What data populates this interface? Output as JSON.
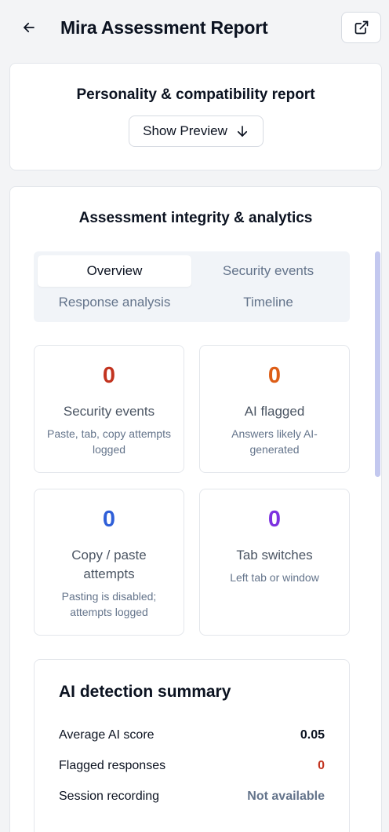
{
  "header": {
    "title": "Mira Assessment Report"
  },
  "personality": {
    "title": "Personality & compatibility report",
    "preview_label": "Show Preview"
  },
  "integrity": {
    "title": "Assessment integrity & analytics",
    "tabs": [
      {
        "label": "Overview",
        "active": true
      },
      {
        "label": "Security events",
        "active": false
      },
      {
        "label": "Response analysis",
        "active": false
      },
      {
        "label": "Timeline",
        "active": false
      }
    ],
    "stats": [
      {
        "value": "0",
        "label": "Security events",
        "desc": "Paste, tab, copy attempts logged",
        "color": "#c2331f"
      },
      {
        "value": "0",
        "label": "AI flagged",
        "desc": "Answers likely AI-generated",
        "color": "#dd5d16"
      },
      {
        "value": "0",
        "label": "Copy / paste attempts",
        "desc": "Pasting is disabled; attempts logged",
        "color": "#2f5fd8"
      },
      {
        "value": "0",
        "label": "Tab switches",
        "desc": "Left tab or window",
        "color": "#7d32e0"
      }
    ],
    "summary": {
      "title": "AI detection summary",
      "rows": [
        {
          "key": "Average AI score",
          "value": "0.05",
          "color": "#0b1220"
        },
        {
          "key": "Flagged responses",
          "value": "0",
          "color": "#c2331f"
        },
        {
          "key": "Session recording",
          "value": "Not available",
          "color": "#64748b"
        }
      ]
    }
  },
  "icons": {
    "back": "arrow-left-icon",
    "external": "external-link-icon",
    "preview": "arrow-down-icon"
  }
}
